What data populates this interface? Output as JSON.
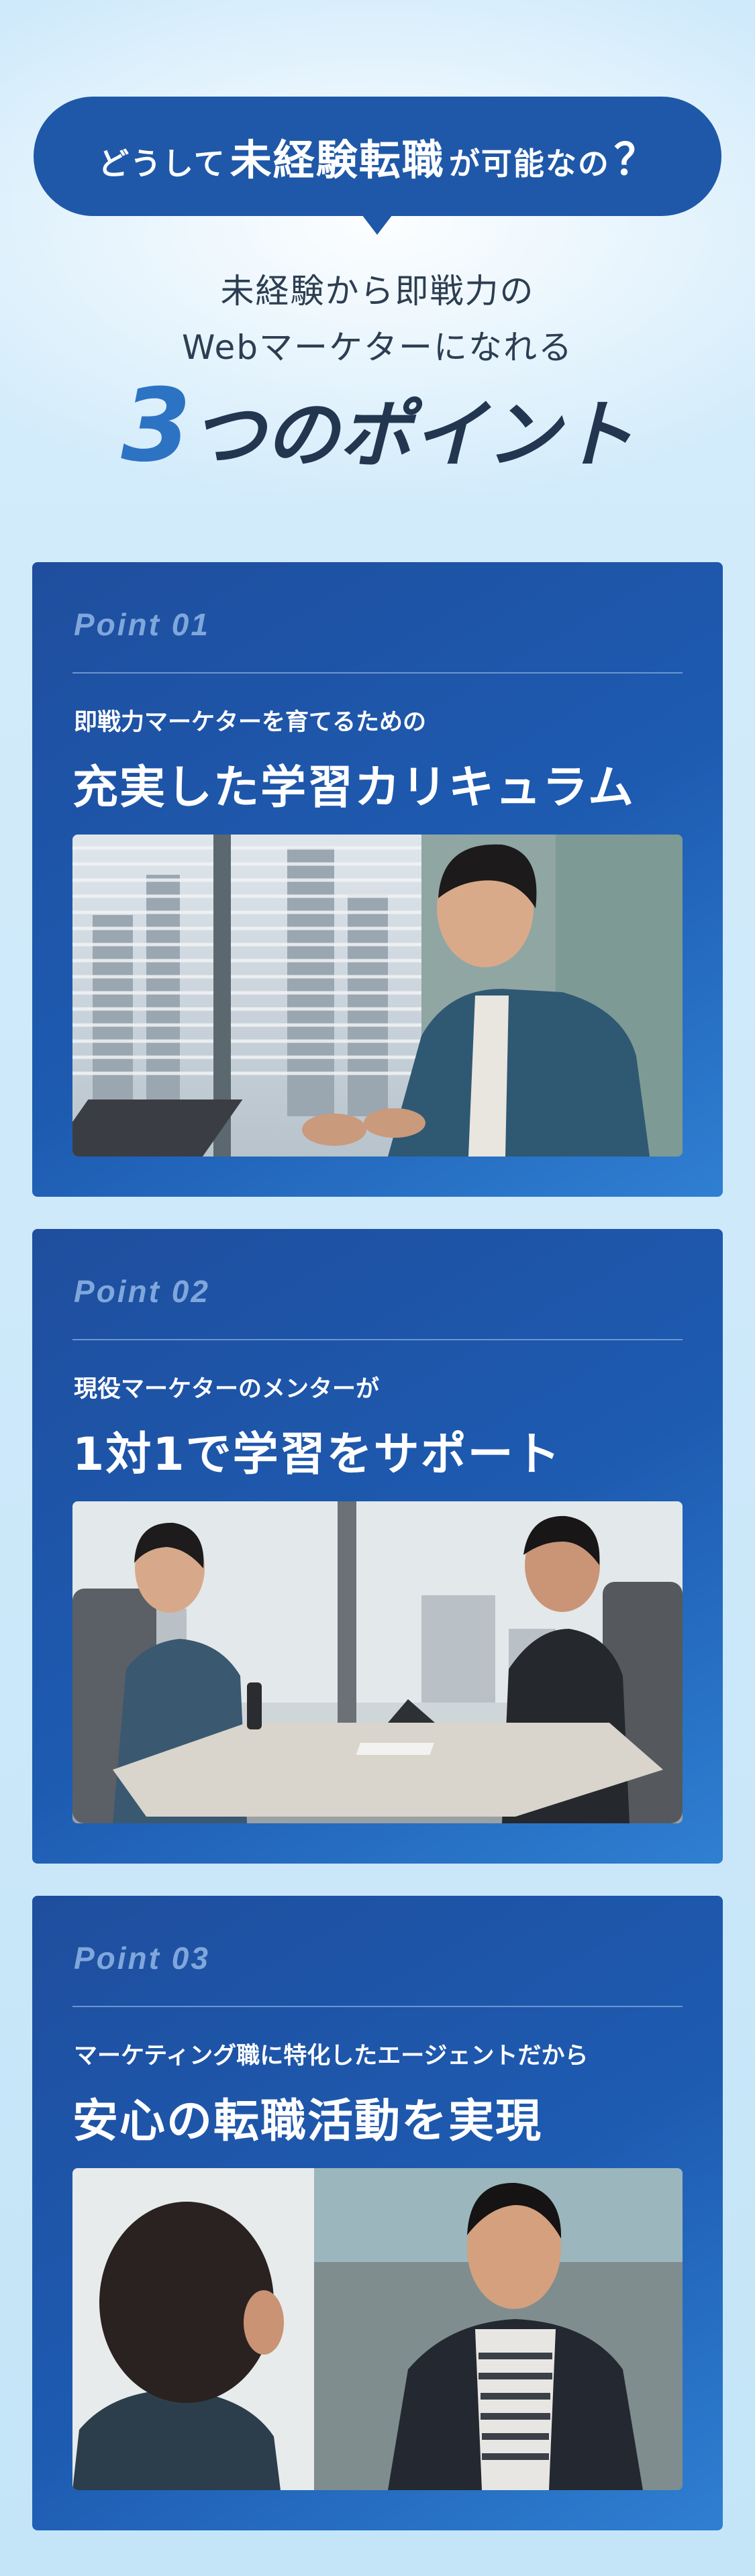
{
  "header": {
    "bubble_part1": "どうして",
    "bubble_emphasis": "未経験転職",
    "bubble_part2": "が可能なの",
    "bubble_q": "？",
    "lead_line1": "未経験から即戦力の",
    "lead_line2": "Webマーケターになれる",
    "headline_number": "3",
    "headline_rest": "つのポイント"
  },
  "points": [
    {
      "label": "Point 01",
      "subtitle": "即戦力マーケターを育てるための",
      "title": "充実した学習カリキュラム",
      "photo": "man-with-laptop-by-window"
    },
    {
      "label": "Point 02",
      "subtitle": "現役マーケターのメンターが",
      "title": "1対1で学習をサポート",
      "photo": "two-men-meeting-at-table"
    },
    {
      "label": "Point 03",
      "subtitle": "マーケティング職に特化したエージェントだから",
      "title": "安心の転職活動を実現",
      "photo": "career-consultation-meeting"
    }
  ],
  "colors": {
    "bubble": "#1f58a8",
    "headline_number": "#2d73c4",
    "card_dark": "#1f4e9e",
    "card_light": "#2f7fd2",
    "point_label": "#7fa7dc"
  }
}
